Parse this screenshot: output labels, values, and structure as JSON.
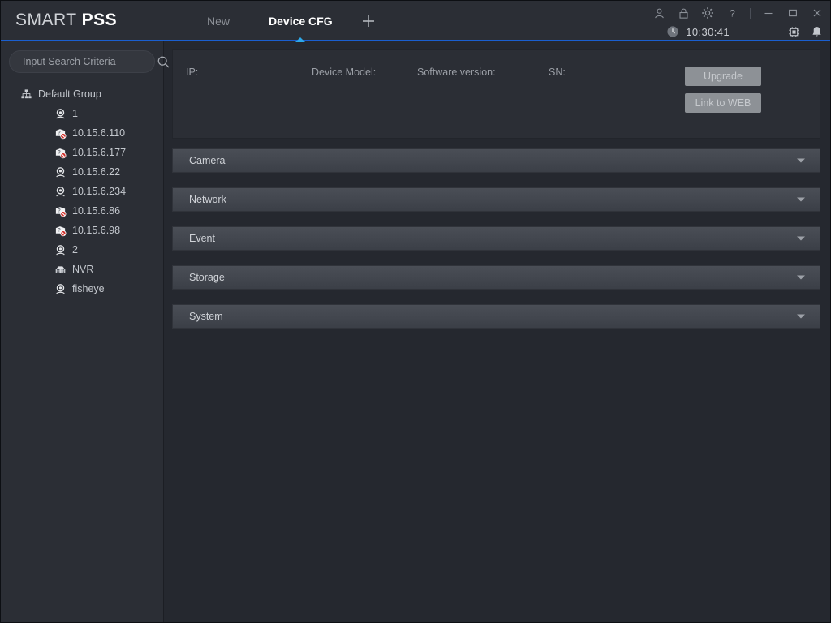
{
  "app": {
    "brand_light": "SMART ",
    "brand_bold": "PSS"
  },
  "titlebar": {
    "tabs": [
      {
        "label": "New",
        "active": false
      },
      {
        "label": "Device CFG",
        "active": true
      }
    ],
    "add_tab_label": "+",
    "sys_icons": [
      {
        "name": "user-icon",
        "label": "user"
      },
      {
        "name": "lock-icon",
        "label": "lock"
      },
      {
        "name": "gear-icon",
        "label": "settings"
      },
      {
        "name": "help-icon",
        "label": "?"
      }
    ],
    "window_controls": [
      {
        "name": "minimize-button",
        "label": "minimize"
      },
      {
        "name": "maximize-button",
        "label": "maximize"
      },
      {
        "name": "close-button",
        "label": "close"
      }
    ],
    "clock": "10:30:41",
    "clock_icon": "clock-icon",
    "status_icons": [
      {
        "name": "cpu-icon",
        "label": "cpu"
      },
      {
        "name": "bell-icon",
        "label": "alarm"
      }
    ],
    "accent_color": "#1a5fd0",
    "active_marker_color": "#2ea8e8"
  },
  "sidebar": {
    "search": {
      "placeholder": "Input Search Criteria",
      "value": "",
      "icon": "search-icon"
    },
    "tree": {
      "group": {
        "label": "Default Group",
        "icon": "sitemap-icon",
        "expanded": true,
        "twisty_icon": "chevron-down-icon"
      },
      "items": [
        {
          "label": "1",
          "icon": "camera-online-icon",
          "status": "online"
        },
        {
          "label": "10.15.6.110",
          "icon": "device-offline-icon",
          "status": "offline"
        },
        {
          "label": "10.15.6.177",
          "icon": "device-offline-icon",
          "status": "offline"
        },
        {
          "label": "10.15.6.22",
          "icon": "camera-online-icon",
          "status": "online"
        },
        {
          "label": "10.15.6.234",
          "icon": "camera-online-icon",
          "status": "online"
        },
        {
          "label": "10.15.6.86",
          "icon": "device-offline-icon",
          "status": "offline"
        },
        {
          "label": "10.15.6.98",
          "icon": "device-offline-icon",
          "status": "offline"
        },
        {
          "label": "2",
          "icon": "camera-online-icon",
          "status": "online"
        },
        {
          "label": "NVR",
          "icon": "nvr-icon",
          "status": "online"
        },
        {
          "label": "fisheye",
          "icon": "camera-online-icon",
          "status": "online"
        }
      ]
    }
  },
  "main": {
    "info": {
      "ip_label": "IP:",
      "ip_value": "",
      "model_label": "Device Model:",
      "model_value": "",
      "software_label": "Software version:",
      "software_value": "",
      "sn_label": "SN:",
      "sn_value": "",
      "upgrade_label": "Upgrade",
      "link_web_label": "Link to WEB"
    },
    "sections": [
      {
        "title": "Camera",
        "expanded": false
      },
      {
        "title": "Network",
        "expanded": false
      },
      {
        "title": "Event",
        "expanded": false
      },
      {
        "title": "Storage",
        "expanded": false
      },
      {
        "title": "System",
        "expanded": false
      }
    ]
  }
}
